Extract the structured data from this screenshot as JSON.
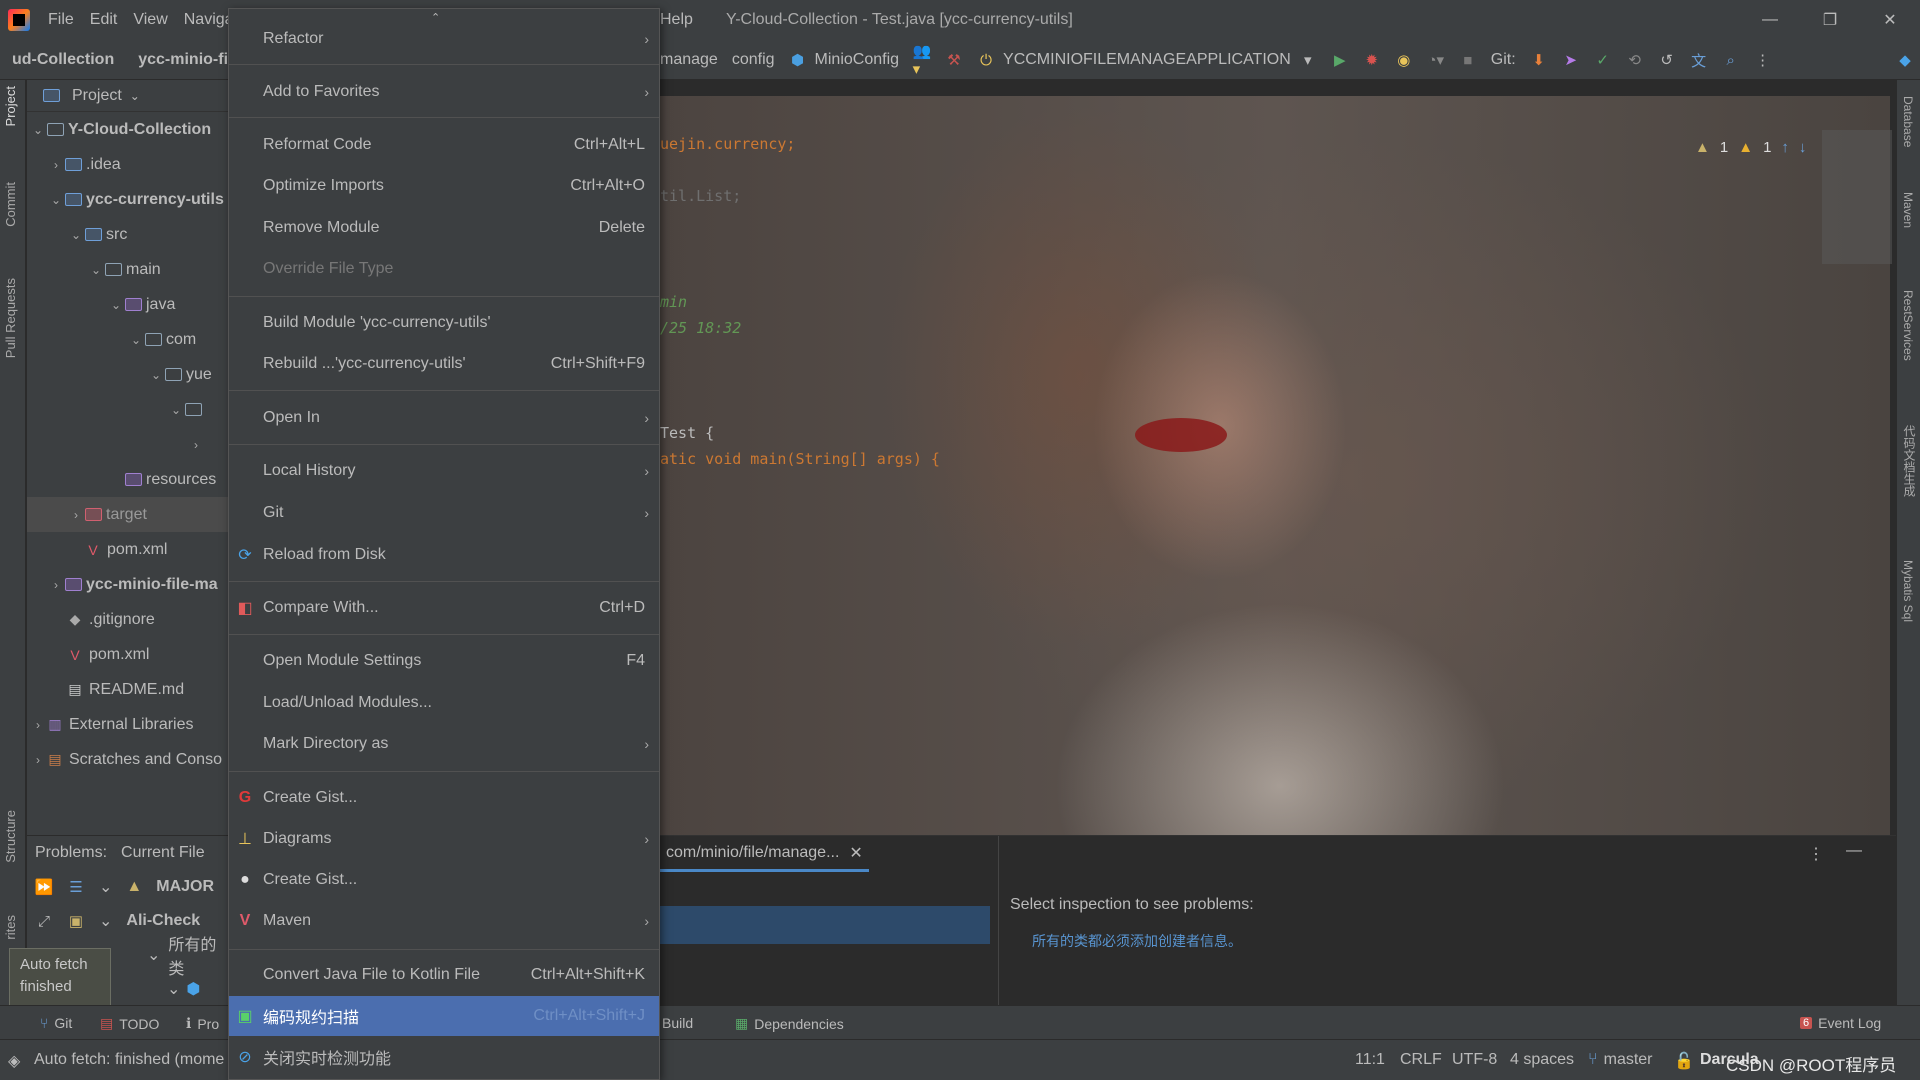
{
  "titlebar": {
    "menus": [
      "File",
      "Edit",
      "View",
      "Naviga",
      "Help"
    ],
    "title": "Y-Cloud-Collection - Test.java [ycc-currency-utils]"
  },
  "navbar": {
    "crumbs": [
      "ud-Collection",
      "ycc-minio-file"
    ],
    "toolbar_items": [
      "manage",
      "config",
      "MinioConfig"
    ],
    "run_config": "YCCMINIOFILEMANAGEAPPLICATION",
    "git_label": "Git:"
  },
  "left_strip": [
    "Project",
    "Commit",
    "Pull Requests",
    "Structure",
    "rites"
  ],
  "right_strip": [
    "Database",
    "Maven",
    "RestServices",
    "代码文档生成",
    "Mybatis Sql"
  ],
  "project": {
    "header": "Project",
    "tree": [
      {
        "label": "Y-Cloud-Collection",
        "bold": true
      },
      {
        "label": ".idea"
      },
      {
        "label": "ycc-currency-utils",
        "bold": true
      },
      {
        "label": "src"
      },
      {
        "label": "main"
      },
      {
        "label": "java"
      },
      {
        "label": "com"
      },
      {
        "label": "yue"
      },
      {
        "label": ""
      },
      {
        "label": ""
      },
      {
        "label": "resources"
      },
      {
        "label": "target"
      },
      {
        "label": "pom.xml"
      },
      {
        "label": "ycc-minio-file-ma",
        "bold": true
      },
      {
        "label": ".gitignore"
      },
      {
        "label": "pom.xml"
      },
      {
        "label": "README.md"
      },
      {
        "label": "External Libraries"
      },
      {
        "label": "Scratches and Conso"
      }
    ]
  },
  "problems": {
    "tabs": [
      "Problems:",
      "Current File"
    ],
    "rows": [
      "MAJOR",
      "Ali-Check",
      "所有的类"
    ],
    "tooltip": "Auto fetch finished"
  },
  "editor": {
    "lines": [
      "uejin.currency;",
      "til.List;",
      "min",
      "/25 18:32",
      "Test {",
      "atic void main(String[] args) {"
    ],
    "warnings": [
      "1",
      "1"
    ]
  },
  "inspect": {
    "tab": "com/minio/file/manage...",
    "placeholder": "Select inspection to see problems:",
    "link": "所有的类都必须添加创建者信息。"
  },
  "context_menu": {
    "items": [
      {
        "label": "Refactor",
        "shortcut": "",
        "submenu": true
      },
      {
        "label": "Add to Favorites",
        "shortcut": "",
        "submenu": true
      },
      {
        "label": "Reformat Code",
        "shortcut": "Ctrl+Alt+L"
      },
      {
        "label": "Optimize Imports",
        "shortcut": "Ctrl+Alt+O"
      },
      {
        "label": "Remove Module",
        "shortcut": "Delete"
      },
      {
        "label": "Override File Type",
        "shortcut": "",
        "disabled": true
      },
      {
        "label": "Build Module 'ycc-currency-utils'",
        "shortcut": ""
      },
      {
        "label": "Rebuild ...'ycc-currency-utils'",
        "shortcut": "Ctrl+Shift+F9"
      },
      {
        "label": "Open In",
        "shortcut": "",
        "submenu": true
      },
      {
        "label": "Local History",
        "shortcut": "",
        "submenu": true
      },
      {
        "label": "Git",
        "shortcut": "",
        "submenu": true
      },
      {
        "label": "Reload from Disk",
        "shortcut": ""
      },
      {
        "label": "Compare With...",
        "shortcut": "Ctrl+D"
      },
      {
        "label": "Open Module Settings",
        "shortcut": "F4"
      },
      {
        "label": "Load/Unload Modules...",
        "shortcut": ""
      },
      {
        "label": "Mark Directory as",
        "shortcut": "",
        "submenu": true
      },
      {
        "label": "Create Gist...",
        "shortcut": ""
      },
      {
        "label": "Diagrams",
        "shortcut": "",
        "submenu": true
      },
      {
        "label": "Create Gist...",
        "shortcut": ""
      },
      {
        "label": "Maven",
        "shortcut": "",
        "submenu": true
      },
      {
        "label": "Convert Java File to Kotlin File",
        "shortcut": "Ctrl+Alt+Shift+K"
      },
      {
        "label": "编码规约扫描",
        "shortcut": "Ctrl+Alt+Shift+J",
        "highlight": true
      },
      {
        "label": "关闭实时检测功能",
        "shortcut": ""
      }
    ]
  },
  "bottom_tabs": [
    "Git",
    "TODO",
    "Pro",
    "Build",
    "Dependencies",
    "Event Log"
  ],
  "event_count": "6",
  "statusbar": {
    "message": "Auto fetch: finished (mome",
    "position": "11:1",
    "line_sep": "CRLF",
    "encoding": "UTF-8",
    "indent": "4 spaces",
    "branch": "master",
    "theme": "Darcula",
    "watermark": "CSDN @ROOT程序员"
  },
  "colors": {
    "highlight": "#4b6eaf",
    "bg": "#3c3f41",
    "editor": "#2b2b2b",
    "keyword": "#cc7832"
  }
}
